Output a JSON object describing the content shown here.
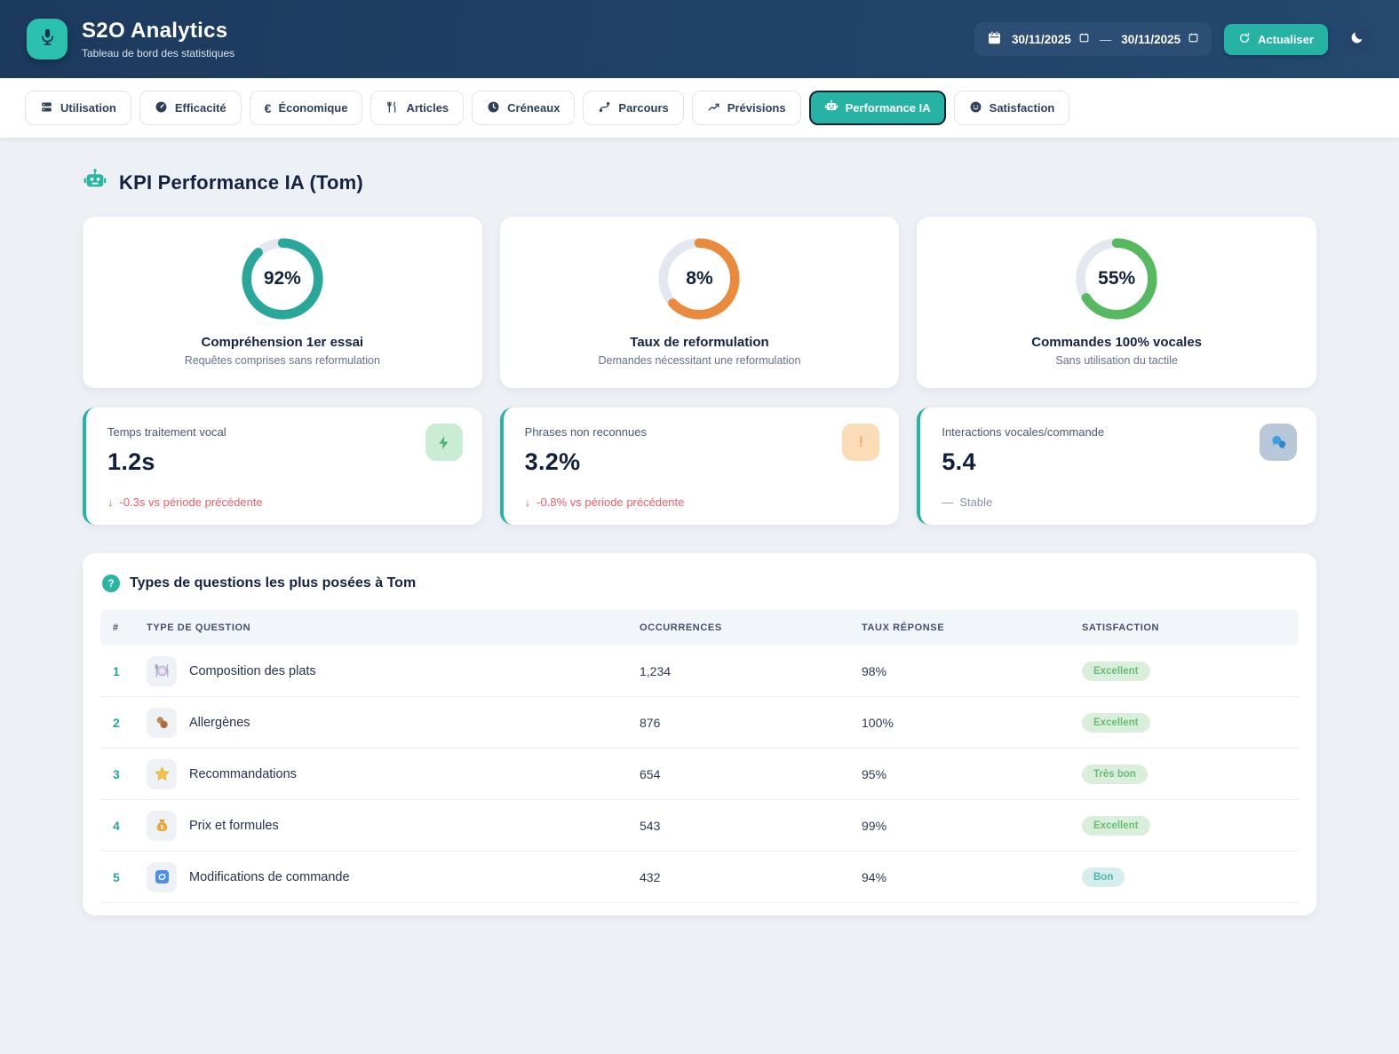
{
  "app": {
    "title": "S2O Analytics",
    "subtitle": "Tableau de bord des statistiques"
  },
  "header": {
    "date_from": "30/11/2025",
    "date_to": "30/11/2025",
    "separator": "—",
    "refresh_label": "Actualiser"
  },
  "tabs": [
    {
      "label": "Utilisation",
      "icon": "usage-icon",
      "active": false
    },
    {
      "label": "Efficacité",
      "icon": "gauge-icon",
      "active": false
    },
    {
      "label": "Économique",
      "icon": "euro-icon",
      "active": false
    },
    {
      "label": "Articles",
      "icon": "utensils-icon",
      "active": false
    },
    {
      "label": "Créneaux",
      "icon": "clock-icon",
      "active": false
    },
    {
      "label": "Parcours",
      "icon": "route-icon",
      "active": false
    },
    {
      "label": "Prévisions",
      "icon": "chart-line-icon",
      "active": false
    },
    {
      "label": "Performance IA",
      "icon": "robot-icon",
      "active": true
    },
    {
      "label": "Satisfaction",
      "icon": "smiley-icon",
      "active": false
    }
  ],
  "section": {
    "title": "KPI Performance IA (Tom)"
  },
  "chart_data": {
    "type": "donut-gauges",
    "gauges": [
      {
        "value_label": "92%",
        "percent": 92,
        "display_fraction": 0.88,
        "color": "#2aa79b",
        "label": "Compréhension 1er essai",
        "sublabel": "Requêtes comprises sans reformulation"
      },
      {
        "value_label": "8%",
        "percent": 8,
        "display_fraction": 0.63,
        "color": "#e98a3c",
        "label": "Taux de reformulation",
        "sublabel": "Demandes nécessitant une reformulation"
      },
      {
        "value_label": "55%",
        "percent": 55,
        "display_fraction": 0.66,
        "color": "#57b95f",
        "label": "Commandes 100% vocales",
        "sublabel": "Sans utilisation du tactile"
      }
    ]
  },
  "stats": [
    {
      "title": "Temps traitement vocal",
      "value": "1.2s",
      "trend_arrow": "↓",
      "trend": "-0.3s vs période précédente",
      "icon": "bolt-icon"
    },
    {
      "title": "Phrases non reconnues",
      "value": "3.2%",
      "trend_arrow": "↓",
      "trend": "-0.8% vs période précédente",
      "icon": "alert-icon"
    },
    {
      "title": "Interactions vocales/commande",
      "value": "5.4",
      "trend_arrow": "—",
      "trend": "Stable",
      "icon": "chat-bubbles-icon"
    }
  ],
  "questions": {
    "title": "Types de questions les plus posées à Tom",
    "columns": [
      "#",
      "Type de question",
      "Occurrences",
      "Taux réponse",
      "Satisfaction"
    ],
    "rows": [
      {
        "rank": "1",
        "icon": "plate-icon",
        "label": "Composition des plats",
        "occurrences": "1,234",
        "response_rate": "98%",
        "satisfaction": "Excellent"
      },
      {
        "rank": "2",
        "icon": "peanut-icon",
        "label": "Allergènes",
        "occurrences": "876",
        "response_rate": "100%",
        "satisfaction": "Excellent"
      },
      {
        "rank": "3",
        "icon": "star-icon",
        "label": "Recommandations",
        "occurrences": "654",
        "response_rate": "95%",
        "satisfaction": "Très bon"
      },
      {
        "rank": "4",
        "icon": "moneybag-icon",
        "label": "Prix et formules",
        "occurrences": "543",
        "response_rate": "99%",
        "satisfaction": "Excellent"
      },
      {
        "rank": "5",
        "icon": "order-refresh-icon",
        "label": "Modifications de commande",
        "occurrences": "432",
        "response_rate": "94%",
        "satisfaction": "Bon"
      }
    ]
  },
  "colors": {
    "accent": "#26b3a4",
    "header_bg": "#1d3b60",
    "trend_down": "#ee5d68",
    "badge_green_bg": "#d9efdc",
    "badge_green_text": "#69bd72",
    "badge_teal_bg": "#d5edec",
    "badge_teal_text": "#4db6ac"
  }
}
